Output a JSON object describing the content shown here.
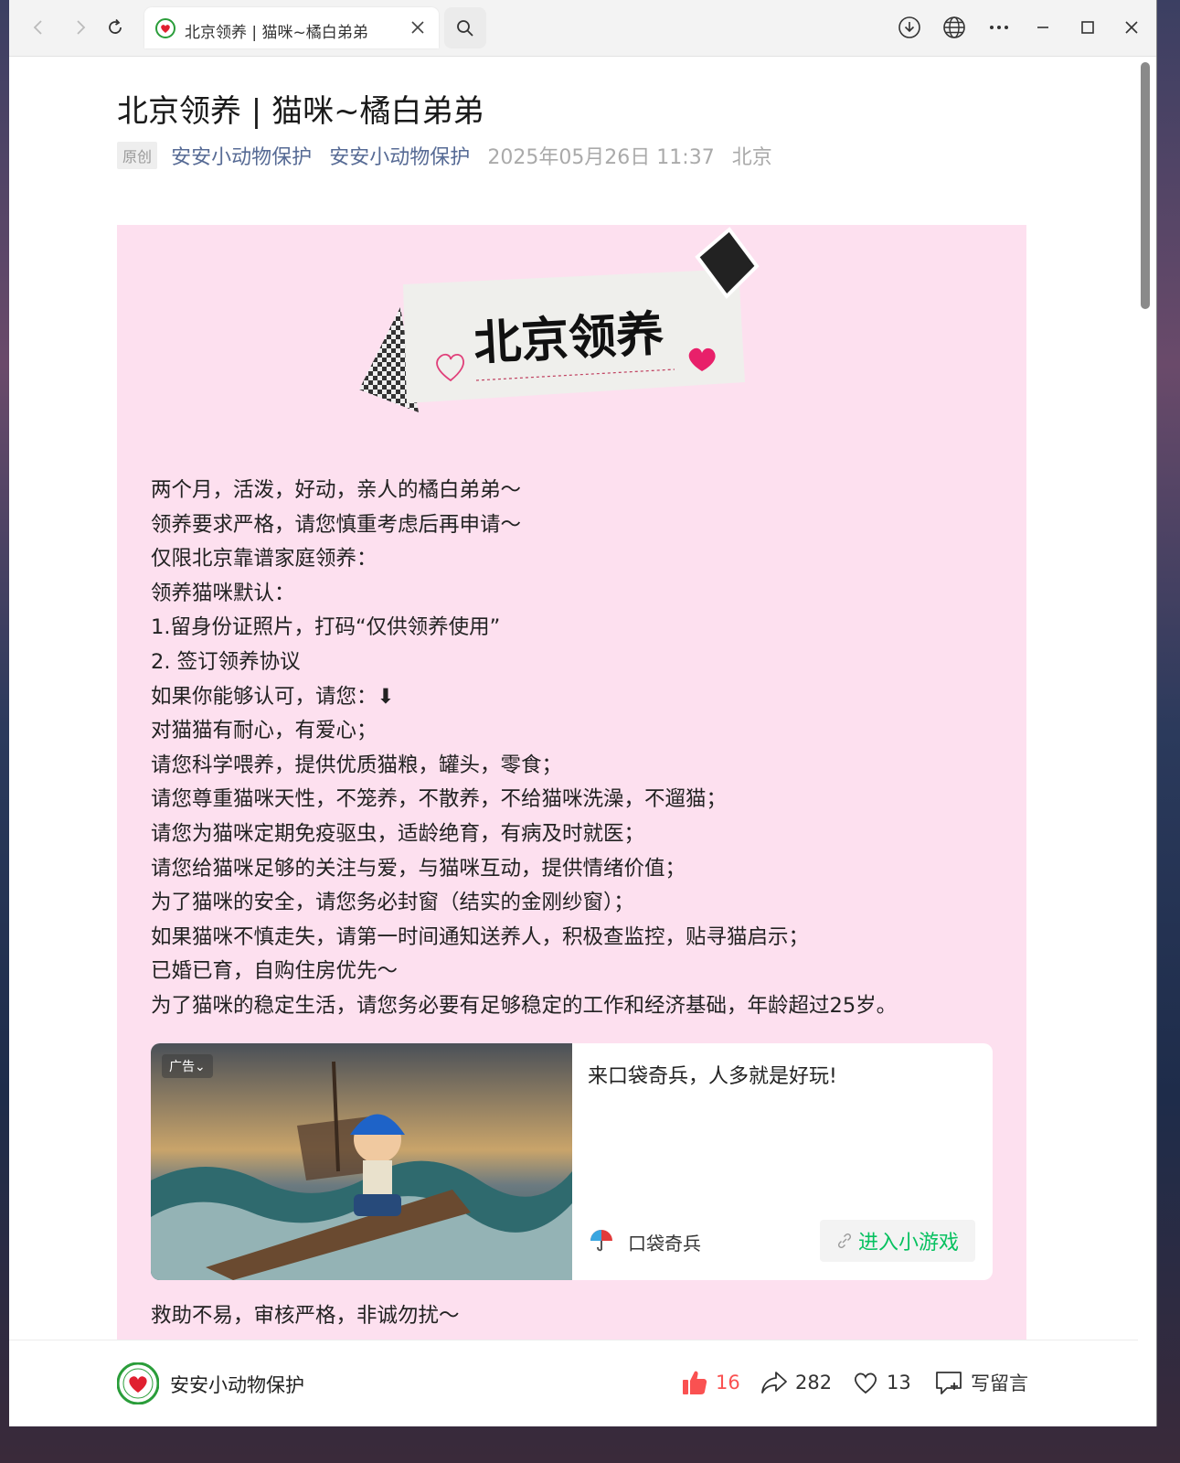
{
  "tab": {
    "title": "北京领养 | 猫咪~橘白弟弟"
  },
  "article": {
    "title": "北京领养 | 猫咪~橘白弟弟",
    "badge": "原创",
    "author_link_1": "安安小动物保护",
    "author_link_2": "安安小动物保护",
    "datetime": "2025年05月26日 11:37",
    "location": "北京",
    "banner_text": "北京领养",
    "lines": [
      "两个月，活泼，好动，亲人的橘白弟弟～",
      "领养要求严格，请您慎重考虑后再申请～",
      "仅限北京靠谱家庭领养：",
      "领养猫咪默认：",
      "1.留身份证照片，打码“仅供领养使用”",
      "2. 签订领养协议",
      "如果你能够认可，请您：⬇",
      "对猫猫有耐心，有爱心；",
      "请您科学喂养，提供优质猫粮，罐头，零食；",
      "请您尊重猫咪天性，不笼养，不散养，不给猫咪洗澡，不遛猫；",
      "请您为猫咪定期免疫驱虫，适龄绝育，有病及时就医；",
      "请您给猫咪足够的关注与爱，与猫咪互动，提供情绪价值；",
      "为了猫咪的安全，请您务必封窗（结实的金刚纱窗）；",
      "如果猫咪不慎走失，请第一时间通知送养人，积极查监控，贴寻猫启示；",
      "已婚已育，自购住房优先～",
      "为了猫咪的稳定生活，请您务必要有足够稳定的工作和经济基础，年龄超过25岁。"
    ],
    "trailing_line": "救助不易，审核严格，非诚勿扰～"
  },
  "ad": {
    "tag": "广告",
    "headline": "来口袋奇兵，人多就是好玩!",
    "brand": "口袋奇兵",
    "cta": "进入小游戏"
  },
  "bottom_bar": {
    "account": "安安小动物保护",
    "likes": "16",
    "shares": "282",
    "favorites": "13",
    "comment_label": "写留言"
  },
  "colors": {
    "link": "#576b95",
    "pink_bg": "#fde0ef",
    "like_red": "#fa5151",
    "cta_green": "#07c160"
  }
}
